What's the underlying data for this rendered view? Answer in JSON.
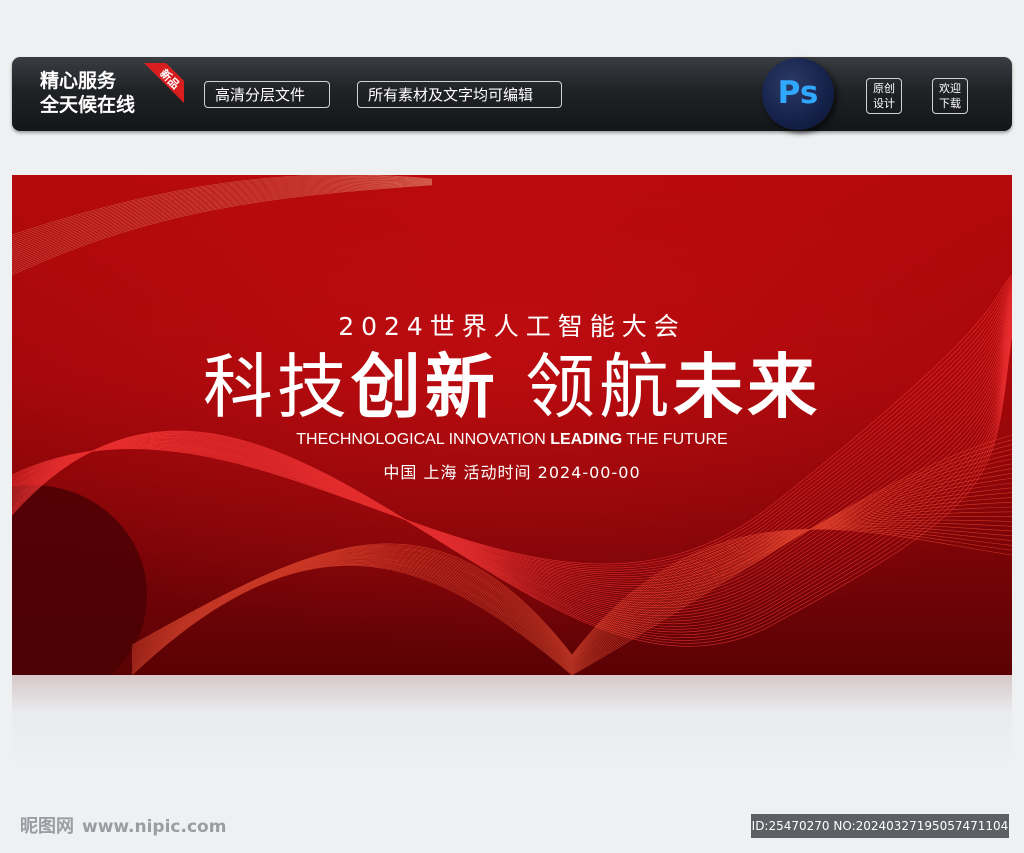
{
  "topbar": {
    "service_line1": "精心服务",
    "service_line2": "全天候在线",
    "ribbon_label": "新品",
    "tag1": "高清分层文件",
    "tag2": "所有素材及文字均可编辑",
    "ps_label": "Ps",
    "badge1_line1": "原创",
    "badge1_line2": "设计",
    "badge2_line1": "欢迎",
    "badge2_line2": "下载"
  },
  "banner": {
    "subtitle": "2024世界人工智能大会",
    "headline_part1": "科技",
    "headline_part2": "创新",
    "headline_part3": "领航",
    "headline_part4": "未来",
    "english_part1": "THECHNOLOGICAL INNOVATION ",
    "english_part2": "LEADING",
    "english_part3": " THE FUTURE",
    "info": "中国 上海  活动时间 2024-00-00",
    "colors": {
      "background": "#a2070a",
      "wave": "#ff2a2a"
    }
  },
  "footer": {
    "watermark_site": "昵图网",
    "watermark_url": "www.nipic.com",
    "image_id": "ID:25470270 NO:20240327195057471104"
  }
}
